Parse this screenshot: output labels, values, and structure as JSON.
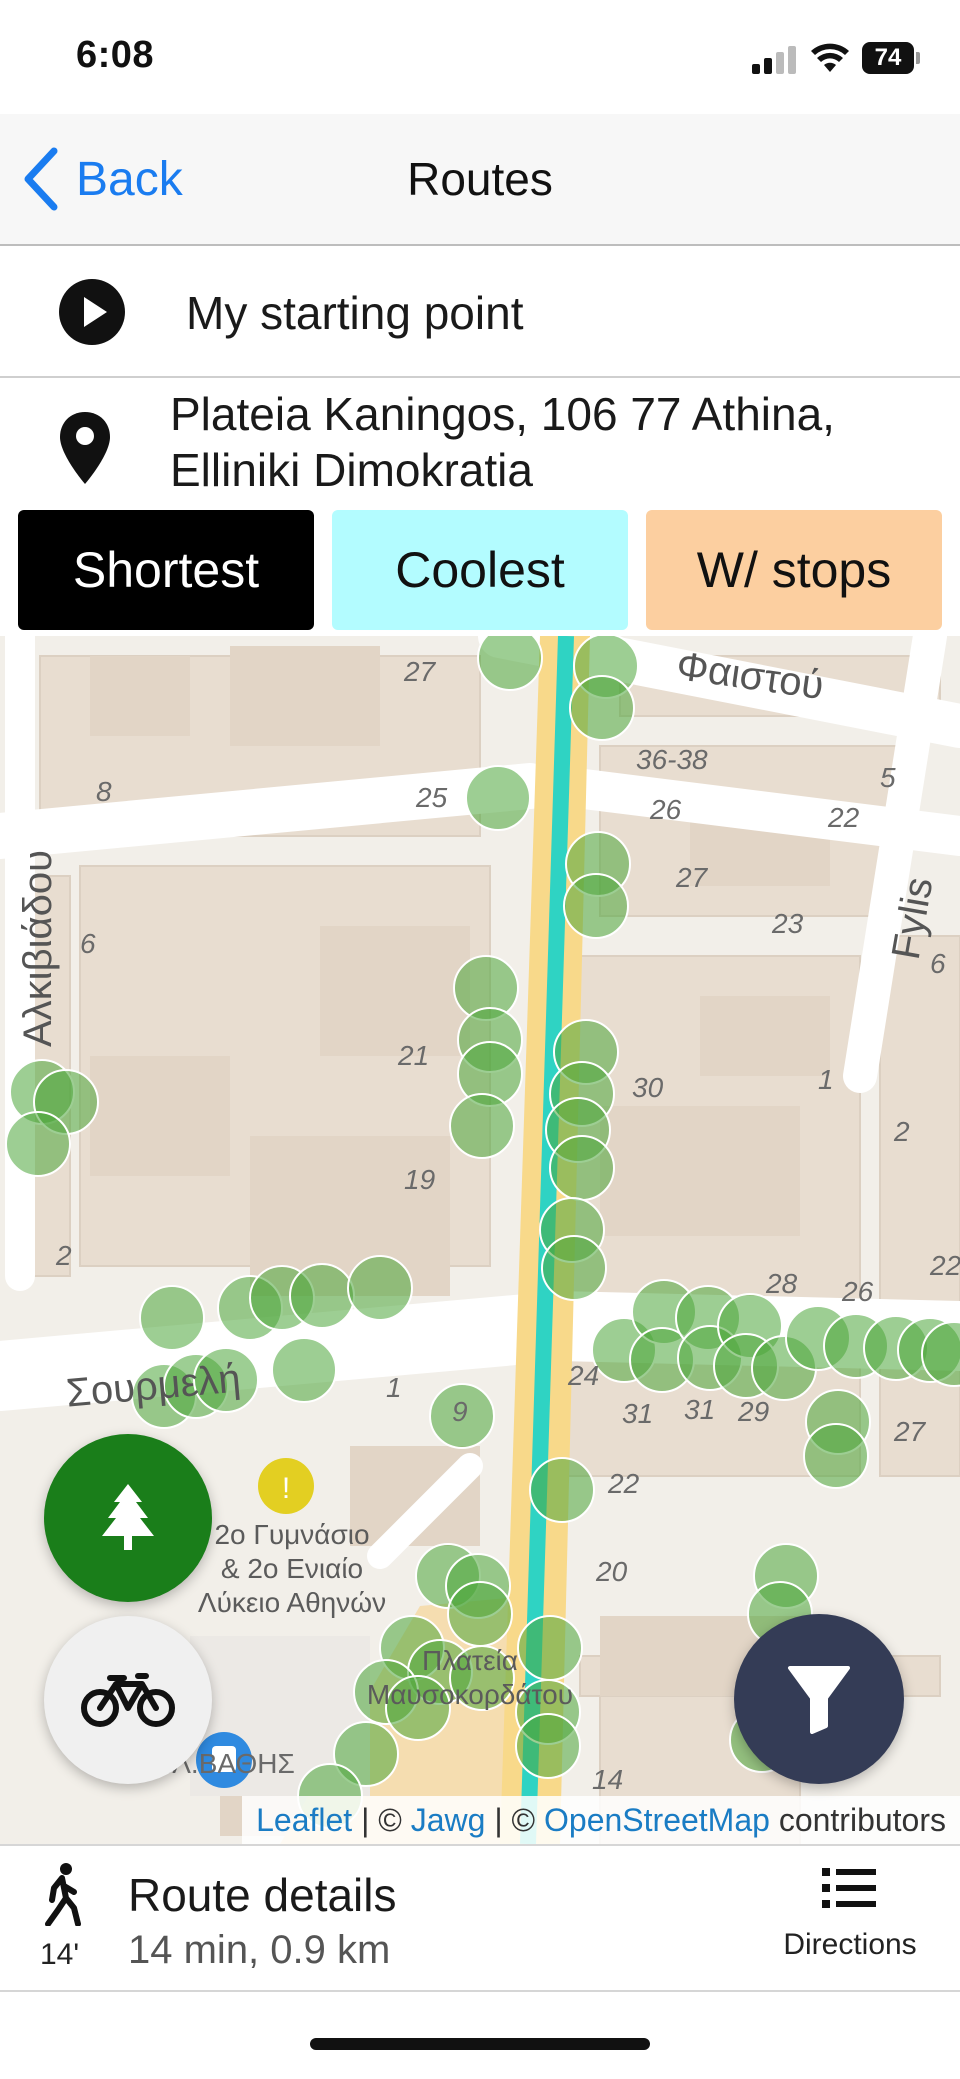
{
  "status_bar": {
    "time": "6:08",
    "battery": "74"
  },
  "nav": {
    "back_label": "Back",
    "title": "Routes"
  },
  "route": {
    "start_label": "My starting point",
    "destination_line1": "Plateia Kaningos, 106 77 Athina,",
    "destination_line2": "Elliniki Dimokratia"
  },
  "tabs": [
    {
      "label": "Shortest",
      "color": "#000000",
      "selected": true
    },
    {
      "label": "Coolest",
      "color": "#b3fcff",
      "selected": false
    },
    {
      "label": "W/ stops",
      "color": "#fccfa0",
      "selected": false
    }
  ],
  "map": {
    "route_color": "#2fd3c3",
    "tree_color": "#4ca53a",
    "street_labels": {
      "faistou": "Φαιστού",
      "alkiviadou": "Αλκιβιάδου",
      "fylis": "Fylis",
      "soupmelt": "Σουρμελή",
      "plateia": "ΠΛ.ΒΑΘΗΣ"
    },
    "numbers": [
      "27",
      "8",
      "25",
      "36-38",
      "26",
      "5",
      "22",
      "27",
      "23",
      "6",
      "6",
      "21",
      "30",
      "1",
      "19",
      "2",
      "2",
      "28",
      "26",
      "22",
      "1",
      "24",
      "31",
      "31",
      "29",
      "27",
      "22",
      "20",
      "14",
      "9"
    ],
    "poi": {
      "school_line1": "2ο Γυμνάσιο",
      "school_line2": "& 2ο Ενιαίο",
      "school_line3": "Λύκειο Αθηνών",
      "square_line1": "Πλατεία",
      "square_line2": "Μαυσοκορδάτου"
    },
    "attribution": {
      "leaflet": "Leaflet",
      "sep1": " | © ",
      "jawg": "Jawg",
      "sep2": " | © ",
      "osm": "OpenStreetMap",
      "suffix": " contributors"
    }
  },
  "fab": {
    "trees_icon": "tree-icon",
    "bike_icon": "bicycle-icon",
    "filter_icon": "filter-icon"
  },
  "details": {
    "walk_minutes": "14'",
    "title": "Route details",
    "summary": "14 min, 0.9 km",
    "directions_label": "Directions"
  }
}
